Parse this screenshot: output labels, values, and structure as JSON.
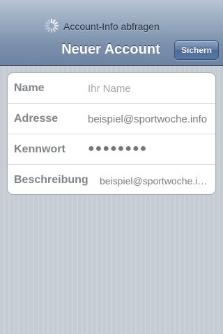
{
  "status": {
    "spinner_icon": "activity-spinner-icon",
    "prompt": "Account-Info abfragen"
  },
  "navbar": {
    "title": "Neuer Account",
    "save_label": "Sichern"
  },
  "form": {
    "rows": [
      {
        "label": "Name",
        "value": "",
        "placeholder": "Ihr Name"
      },
      {
        "label": "Adresse",
        "value": "beispiel@sportwoche.info",
        "placeholder": ""
      },
      {
        "label": "Kennwort",
        "value": "●●●●●●●●",
        "placeholder": ""
      },
      {
        "label": "Beschreibung",
        "value": "beispiel@sportwoche.info",
        "placeholder": ""
      }
    ]
  },
  "colors": {
    "navbar_bottom": "#6d84a2",
    "navbar_top": "#b7c3d2",
    "save_button": "#5b79a3",
    "background": "#c5ccd4",
    "label_text": "#7f8489"
  }
}
